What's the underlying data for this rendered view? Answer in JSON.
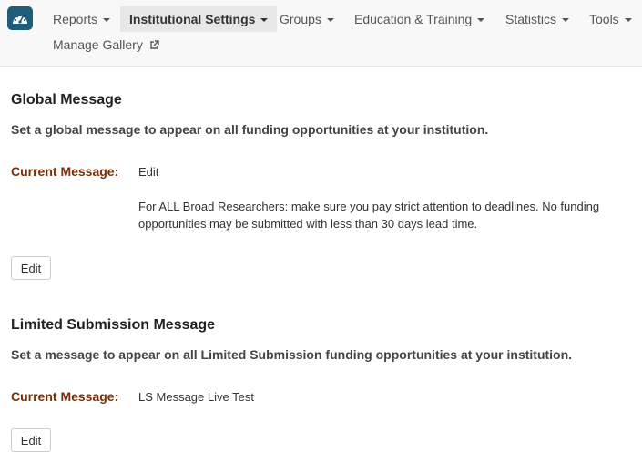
{
  "nav": {
    "logo_icon": "speedometer-icon",
    "items": [
      {
        "label": "Reports",
        "dropdown": true
      },
      {
        "label": "Institutional Settings",
        "dropdown": true,
        "active": true
      },
      {
        "label": "Groups",
        "dropdown": true
      },
      {
        "label": "Education & Training",
        "dropdown": true
      },
      {
        "label": "Statistics",
        "dropdown": true
      },
      {
        "label": "Tools",
        "dropdown": true
      },
      {
        "label": "Manage Gallery",
        "external_link_icon": "external-link-icon"
      }
    ]
  },
  "global": {
    "title": "Global Message",
    "description": "Set a global message to appear on all funding opportunities at your institution.",
    "current_label": "Current Message:",
    "current_value": "Edit",
    "message_body": "For ALL Broad Researchers: make sure you pay strict attention to deadlines.  No funding opportunities may be submitted with less than 30 days lead time.",
    "edit_button": "Edit"
  },
  "limited": {
    "title": "Limited Submission Message",
    "description": "Set a message to appear on all Limited Submission funding opportunities at your institution.",
    "current_label": "Current Message:",
    "current_value": "LS Message Live Test",
    "edit_button": "Edit"
  },
  "colors": {
    "label_color": "#7a2f06",
    "logo_bg": "#1f5d7a",
    "nav_bg": "#f8f8f8",
    "active_nav_bg": "#e7e7e7"
  }
}
